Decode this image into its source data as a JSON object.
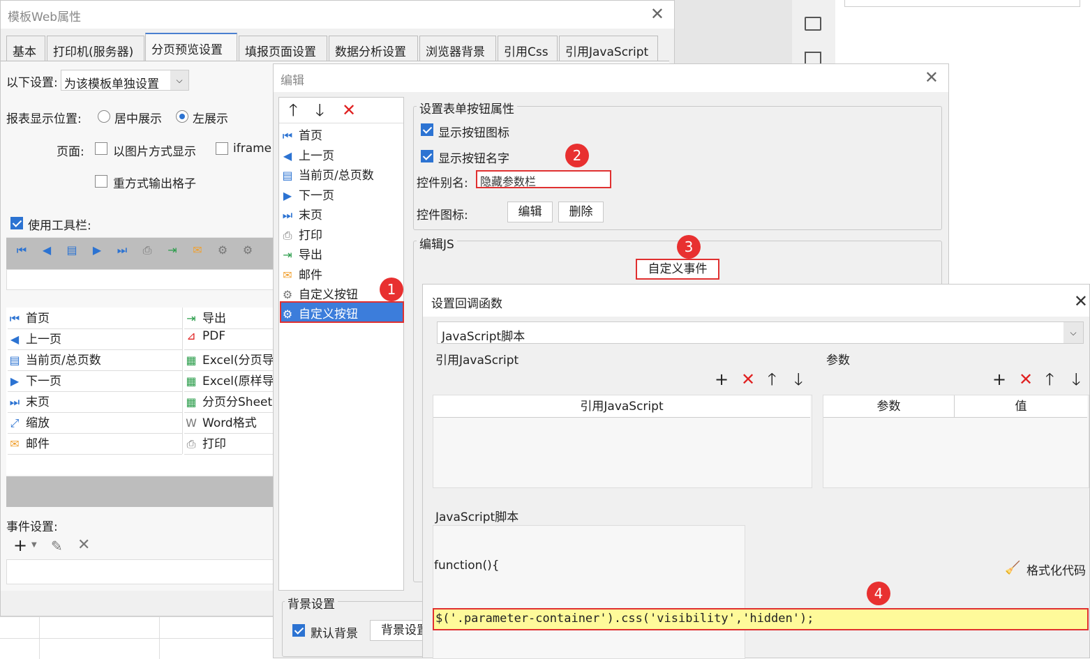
{
  "main": {
    "title": "模板Web属性",
    "tabs": [
      "基本",
      "打印机(服务器)",
      "分页预览设置",
      "填报页面设置",
      "数据分析设置",
      "浏览器背景",
      "引用Css",
      "引用JavaScript"
    ],
    "settings_label": "以下设置:",
    "settings_value": "为该模板单独设置",
    "position_label": "报表显示位置:",
    "position_center": "居中展示",
    "position_left": "左展示",
    "page_label": "页面:",
    "page_image": "以图片方式显示",
    "page_iframe": "iframe",
    "grid_option": "重方式输出格子",
    "use_toolbar": "使用工具栏:",
    "toolbar_items_left": [
      "首页",
      "上一页",
      "当前页/总页数",
      "下一页",
      "末页",
      "缩放",
      "邮件"
    ],
    "toolbar_items_right": [
      "导出",
      "PDF",
      "Excel(分页导",
      "Excel(原样导",
      "分页分Sheet",
      "Word格式",
      "打印"
    ],
    "event_label": "事件设置:"
  },
  "edit": {
    "title": "编辑",
    "list": [
      "首页",
      "上一页",
      "当前页/总页数",
      "下一页",
      "末页",
      "打印",
      "导出",
      "邮件",
      "自定义按钮",
      "自定义按钮"
    ],
    "group_title": "设置表单按钮属性",
    "show_icon": "显示按钮图标",
    "show_name": "显示按钮名字",
    "alias_label": "控件别名:",
    "alias_value": "隐藏参数栏",
    "icon_label": "控件图标:",
    "edit_btn": "编辑",
    "delete_btn": "删除",
    "js_label": "编辑JS",
    "custom_event": "自定义事件",
    "bg_title": "背景设置",
    "default_bg": "默认背景",
    "bg_btn": "背景设置"
  },
  "callback": {
    "title": "设置回调函数",
    "type_value": "JavaScript脚本",
    "ref_js_label": "引用JavaScript",
    "params_label": "参数",
    "ref_js_header": "引用JavaScript",
    "param_header": "参数",
    "value_header": "值",
    "script_label": "JavaScript脚本",
    "format_code": "格式化代码",
    "func_head": "function(){",
    "code": "$('.parameter-container').css('visibility','hidden');"
  },
  "badges": [
    "1",
    "2",
    "3",
    "4"
  ]
}
